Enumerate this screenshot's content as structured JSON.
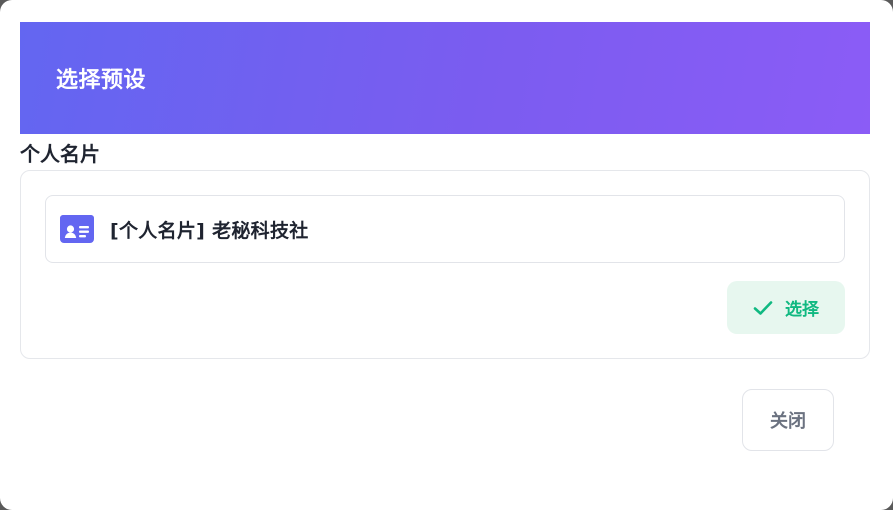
{
  "dialog": {
    "title": "选择预设",
    "close_label": "关闭"
  },
  "section": {
    "title": "个人名片"
  },
  "preset": {
    "icon": "id-card-icon",
    "label": "[个人名片] 老秘科技社",
    "select_label": "选择",
    "select_icon": "check-icon"
  },
  "colors": {
    "header_gradient_start": "#6366f1",
    "header_gradient_end": "#8b5cf6",
    "icon_color": "#6366f1",
    "select_text": "#10b981",
    "select_bg": "#e7f7ef",
    "close_text": "#6b7280"
  }
}
